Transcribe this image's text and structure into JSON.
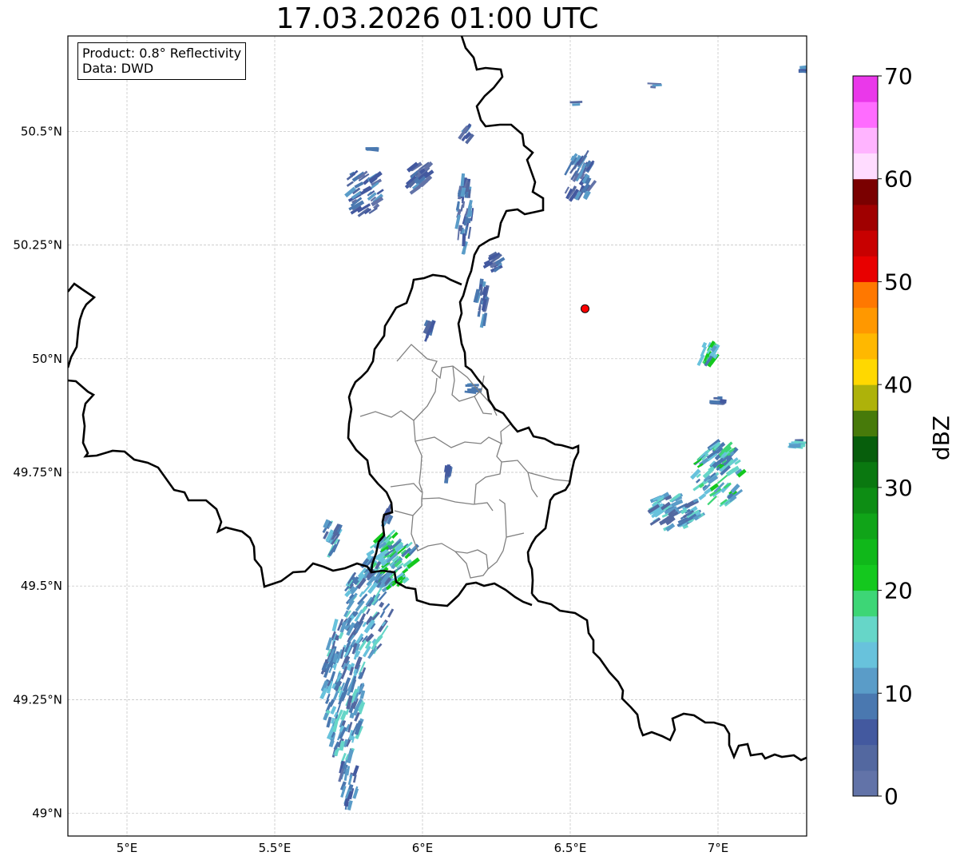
{
  "title": "17.03.2026 01:00 UTC",
  "info": {
    "product": "Product: 0.8° Reflectivity",
    "source": "Data: DWD"
  },
  "map": {
    "lon_range": [
      4.8,
      7.3
    ],
    "lat_range": [
      48.95,
      50.71
    ],
    "lon_ticks": [
      {
        "v": 5.0,
        "label": "5°E"
      },
      {
        "v": 5.5,
        "label": "5.5°E"
      },
      {
        "v": 6.0,
        "label": "6°E"
      },
      {
        "v": 6.5,
        "label": "6.5°E"
      },
      {
        "v": 7.0,
        "label": "7°E"
      }
    ],
    "lat_ticks": [
      {
        "v": 49.0,
        "label": "49°N"
      },
      {
        "v": 49.25,
        "label": "49.25°N"
      },
      {
        "v": 49.5,
        "label": "49.5°N"
      },
      {
        "v": 49.75,
        "label": "49.75°N"
      },
      {
        "v": 50.0,
        "label": "50°N"
      },
      {
        "v": 50.25,
        "label": "50.25°N"
      },
      {
        "v": 50.5,
        "label": "50.5°N"
      }
    ],
    "grid": true,
    "radar_site": {
      "lon": 6.55,
      "lat": 50.11,
      "color": "#ff0000"
    }
  },
  "colorbar": {
    "label": "dBZ",
    "min": 0,
    "max": 70,
    "step": 2.5,
    "ticks": [
      0,
      10,
      20,
      30,
      40,
      50,
      60,
      70
    ],
    "colors": [
      "#6273a8",
      "#5368a0",
      "#43599f",
      "#4a78b0",
      "#5a9cc8",
      "#68c2dc",
      "#66d6c8",
      "#3dd676",
      "#14c81e",
      "#10b81a",
      "#10a418",
      "#0d8d14",
      "#0a7810",
      "#075e0c",
      "#477a0a",
      "#aeb20a",
      "#ffd800",
      "#ffb800",
      "#ff9800",
      "#ff7800",
      "#e80000",
      "#c80000",
      "#a00000",
      "#7a0000",
      "#ffdcff",
      "#ffb4ff",
      "#ff6cff",
      "#ea38ea"
    ]
  }
}
